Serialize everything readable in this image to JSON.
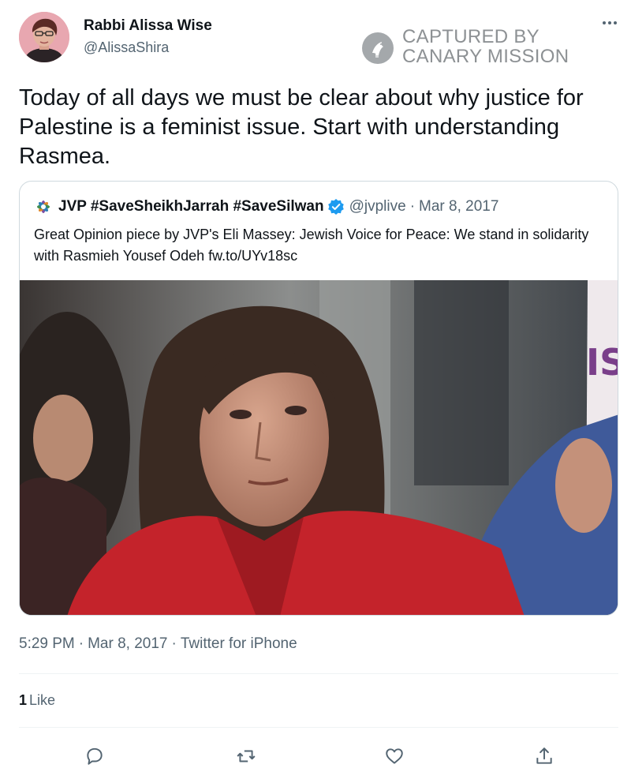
{
  "author": {
    "display_name": "Rabbi Alissa Wise",
    "handle": "@AlissaShira"
  },
  "watermark": {
    "line1": "CAPTURED BY",
    "line2": "CANARY MISSION"
  },
  "more_icon": "more-horizontal-icon",
  "tweet": {
    "text": "Today of all days we must be clear about why justice for Palestine is a feminist issue. Start with understanding  Rasmea.",
    "time": "5:29 PM",
    "date": "Mar 8, 2017",
    "source": "Twitter for iPhone",
    "separator": "·"
  },
  "quoted_tweet": {
    "display_name": "JVP #SaveSheikhJarrah #SaveSilwan",
    "handle": "@jvplive",
    "separator": "·",
    "date": "Mar 8, 2017",
    "text": "Great Opinion piece by JVP's Eli Massey: Jewish Voice for Peace: We stand in solidarity with Rasmieh Yousef Odeh fw.to/UYv18sc",
    "verified_icon": "verified-badge-icon",
    "photo_sign_text": "IS"
  },
  "engagement": {
    "likes_count": "1",
    "likes_label": "Like"
  },
  "actions": [
    {
      "name": "reply-icon"
    },
    {
      "name": "retweet-icon"
    },
    {
      "name": "like-icon"
    },
    {
      "name": "share-icon"
    }
  ],
  "colors": {
    "text_primary": "#0f1419",
    "text_secondary": "#536471",
    "border": "#cfd9de",
    "verified_blue": "#1d9bf0"
  }
}
